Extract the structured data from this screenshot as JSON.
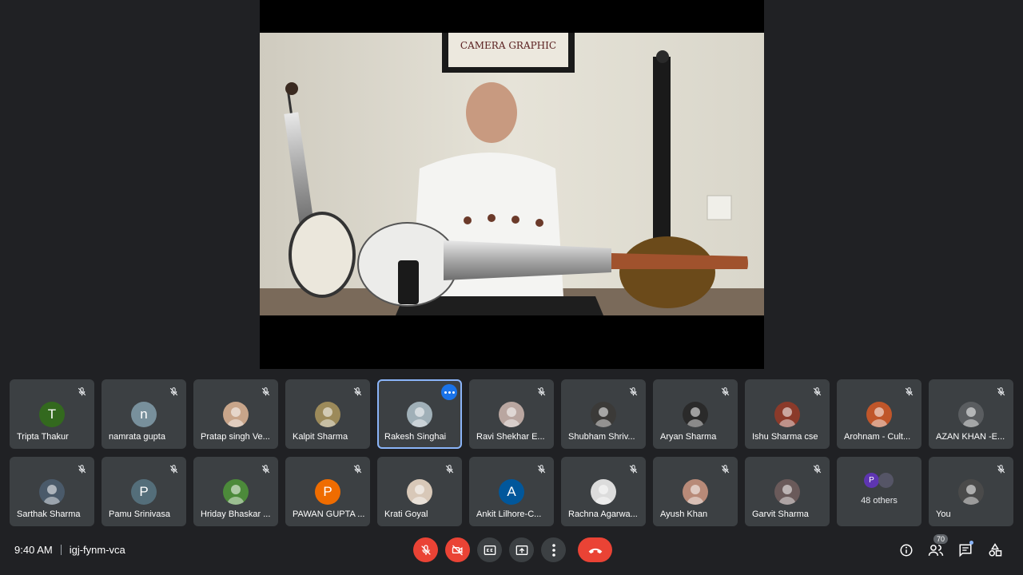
{
  "presentation": {
    "frame_text": "CAMERA GRAPHIC"
  },
  "participants_row1": [
    {
      "name": "Tripta Thakur",
      "avatar_type": "letter",
      "initial": "T",
      "color": "#33691e"
    },
    {
      "name": "namrata gupta",
      "avatar_type": "letter",
      "initial": "n",
      "color": "#78909c"
    },
    {
      "name": "Pratap singh Ve...",
      "avatar_type": "photo",
      "color": "#c8a58a"
    },
    {
      "name": "Kalpit Sharma",
      "avatar_type": "photo",
      "color": "#9c8a5a"
    },
    {
      "name": "Rakesh Singhai",
      "avatar_type": "photo",
      "color": "#a0b0b8",
      "active": true
    },
    {
      "name": "Ravi Shekhar E...",
      "avatar_type": "photo",
      "color": "#b9a6a0"
    },
    {
      "name": "Shubham Shriv...",
      "avatar_type": "photo",
      "color": "#3b3a38"
    },
    {
      "name": "Aryan Sharma",
      "avatar_type": "photo",
      "color": "#2a2a2a"
    },
    {
      "name": "Ishu Sharma cse",
      "avatar_type": "photo",
      "color": "#8b3a2a"
    },
    {
      "name": "Arohnam - Cult...",
      "avatar_type": "photo",
      "color": "#c0562a"
    },
    {
      "name": "AZAN KHAN -E...",
      "avatar_type": "photo",
      "color": "#5a5d60"
    }
  ],
  "participants_row2": [
    {
      "name": "Sarthak Sharma",
      "avatar_type": "photo",
      "color": "#4a5a6a"
    },
    {
      "name": "Pamu Srinivasa",
      "avatar_type": "letter",
      "initial": "P",
      "color": "#546e7a"
    },
    {
      "name": "Hriday Bhaskar ...",
      "avatar_type": "photo",
      "color": "#4c8a3a"
    },
    {
      "name": "PAWAN GUPTA ...",
      "avatar_type": "letter",
      "initial": "P",
      "color": "#ef6c00"
    },
    {
      "name": "Krati Goyal",
      "avatar_type": "photo",
      "color": "#d8c8b8"
    },
    {
      "name": "Ankit Lilhore-C...",
      "avatar_type": "letter",
      "initial": "A",
      "color": "#01579b"
    },
    {
      "name": "Rachna Agarwa...",
      "avatar_type": "photo",
      "color": "#dcdcdc"
    },
    {
      "name": "Ayush Khan",
      "avatar_type": "photo",
      "color": "#b88a78"
    },
    {
      "name": "Garvit Sharma",
      "avatar_type": "photo",
      "color": "#6a5a5a"
    }
  ],
  "others_tile": {
    "label": "48 others",
    "initial": "P"
  },
  "self_tile": {
    "name": "You"
  },
  "bottom_bar": {
    "time": "9:40 AM",
    "meeting_code": "igj-fynm-vca",
    "people_count": "70"
  },
  "icons": {
    "mic": "mic-off-icon",
    "camera": "videocam-off-icon",
    "captions": "captions-icon",
    "present": "present-screen-icon",
    "more": "more-vert-icon",
    "end_call": "call-end-icon",
    "info": "info-icon",
    "people": "people-icon",
    "chat": "chat-icon",
    "activities": "activities-icon"
  },
  "colors": {
    "background": "#202124",
    "tile": "#3c4043",
    "danger": "#ea4335",
    "active_outline": "#8ab4f8"
  }
}
